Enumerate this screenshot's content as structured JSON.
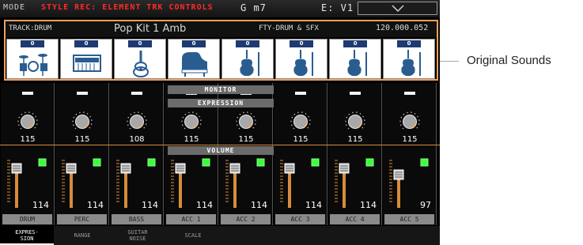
{
  "topbar": {
    "mode_label": "MODE",
    "mode_text": "STYLE REC: ELEMENT TRK CONTROLS",
    "chord": "G m7",
    "variation": "E: V1"
  },
  "track": {
    "label": "TRACK:DRUM",
    "kit_name": "Pop Kit 1 Amb",
    "bank": "FTY-DRUM & SFX",
    "program": "120.000.052",
    "slots": [
      {
        "tag": "0",
        "icon": "drum-kit-icon"
      },
      {
        "tag": "0",
        "icon": "keyboard-icon"
      },
      {
        "tag": "0",
        "icon": "guitar-icon"
      },
      {
        "tag": "0",
        "icon": "piano-icon"
      },
      {
        "tag": "0",
        "icon": "violin-icon"
      },
      {
        "tag": "0",
        "icon": "violin-icon"
      },
      {
        "tag": "0",
        "icon": "violin-icon"
      },
      {
        "tag": "0",
        "icon": "violin-icon"
      }
    ]
  },
  "sections": {
    "monitor": "MONITOR",
    "expression": "EXPRESSION",
    "volume": "VOLUME"
  },
  "strips": [
    {
      "name": "DRUM",
      "expression": "115",
      "volume": "114"
    },
    {
      "name": "PERC",
      "expression": "115",
      "volume": "114"
    },
    {
      "name": "BASS",
      "expression": "108",
      "volume": "114"
    },
    {
      "name": "ACC 1",
      "expression": "115",
      "volume": "114"
    },
    {
      "name": "ACC 2",
      "expression": "115",
      "volume": "114"
    },
    {
      "name": "ACC 3",
      "expression": "115",
      "volume": "114"
    },
    {
      "name": "ACC 4",
      "expression": "115",
      "volume": "114"
    },
    {
      "name": "ACC 5",
      "expression": "115",
      "volume": "97"
    }
  ],
  "tabs": [
    {
      "line1": "EXPRES-",
      "line2": "SION"
    },
    {
      "line1": "RANGE",
      "line2": ""
    },
    {
      "line1": "GUITAR",
      "line2": "NOISE"
    },
    {
      "line1": "SCALE",
      "line2": ""
    }
  ],
  "callout": "Original Sounds",
  "colors": {
    "accent_orange": "#f0a060",
    "mode_red": "#ff2a2a",
    "mute_green": "#3cff3c",
    "tag_blue": "#1e3a70"
  }
}
